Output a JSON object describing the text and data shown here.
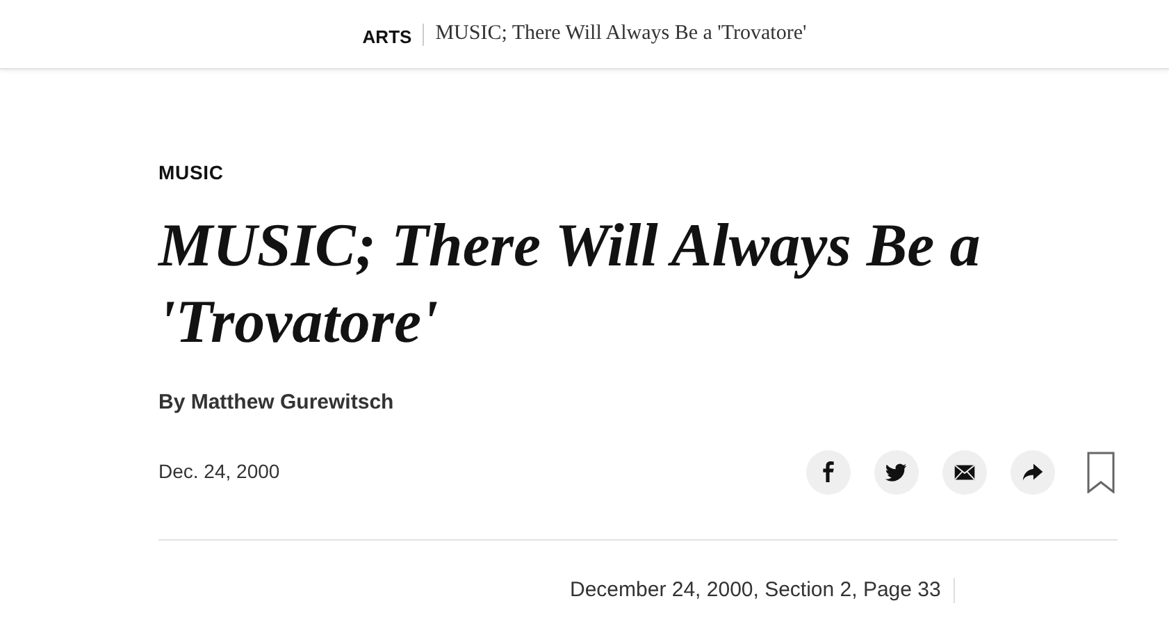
{
  "header": {
    "section": "ARTS",
    "title": "MUSIC; There Will Always Be a 'Trovatore'"
  },
  "article": {
    "kicker": "MUSIC",
    "headline": "MUSIC; There Will Always Be a 'Trovatore'",
    "byline": "By Matthew Gurewitsch",
    "date": "Dec. 24, 2000",
    "share": [
      {
        "kind": "facebook"
      },
      {
        "kind": "twitter"
      },
      {
        "kind": "email"
      },
      {
        "kind": "share"
      },
      {
        "kind": "bookmark"
      }
    ],
    "print_info": "December 24, 2000, Section 2, Page 33"
  }
}
